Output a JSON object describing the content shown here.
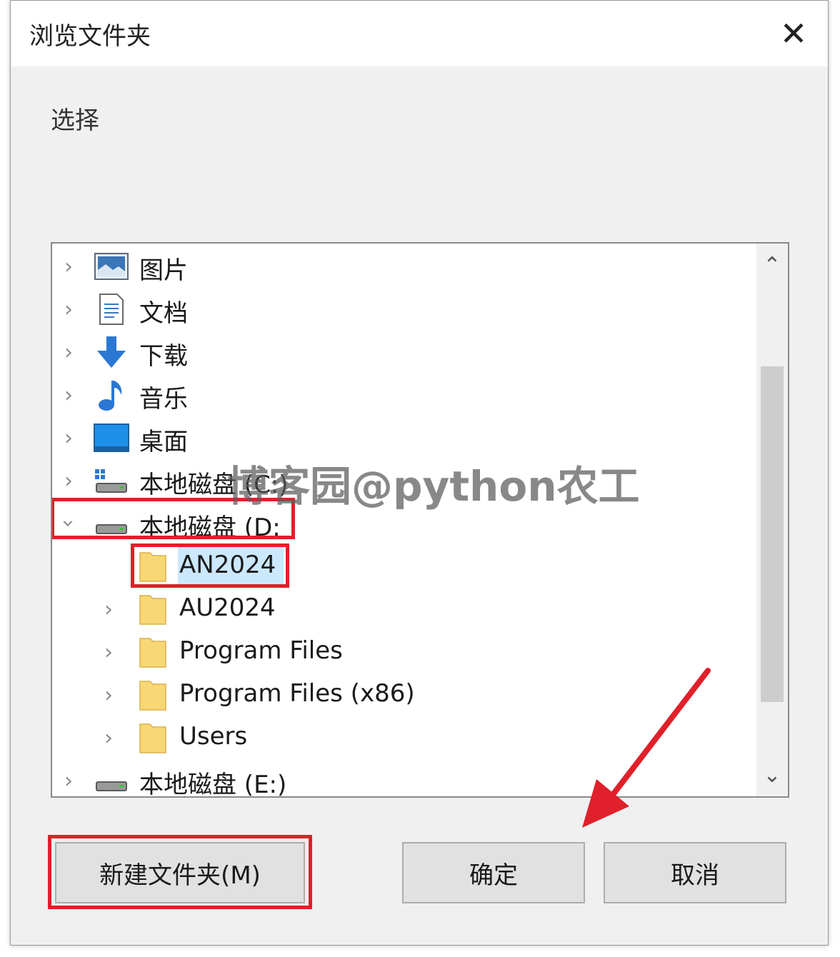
{
  "dialog": {
    "title": "浏览文件夹",
    "prompt": "选择",
    "close_glyph": "✕"
  },
  "tree": {
    "items": [
      {
        "label": "图片",
        "icon": "pictures-icon",
        "expanded": false
      },
      {
        "label": "文档",
        "icon": "documents-icon",
        "expanded": false
      },
      {
        "label": "下载",
        "icon": "download-icon",
        "expanded": false
      },
      {
        "label": "音乐",
        "icon": "music-icon",
        "expanded": false
      },
      {
        "label": "桌面",
        "icon": "desktop-icon",
        "expanded": false
      },
      {
        "label": "本地磁盘 (C:)",
        "icon": "system-drive-icon",
        "expanded": false
      },
      {
        "label": "本地磁盘 (D:",
        "icon": "drive-icon",
        "expanded": true
      },
      {
        "label": "AN2024",
        "icon": "folder-icon",
        "selected": true
      },
      {
        "label": "AU2024",
        "icon": "folder-icon",
        "expanded": false
      },
      {
        "label": "Program Files",
        "icon": "folder-icon",
        "expanded": false
      },
      {
        "label": "Program Files (x86)",
        "icon": "folder-icon",
        "expanded": false
      },
      {
        "label": "Users",
        "icon": "folder-icon",
        "expanded": false
      },
      {
        "label": "本地磁盘 (E:)",
        "icon": "drive-icon",
        "expanded": false
      }
    ]
  },
  "buttons": {
    "new_folder": "新建文件夹(M)",
    "ok": "确定",
    "cancel": "取消"
  },
  "watermark": "博客园@python农工",
  "colors": {
    "highlight_red": "#e0202a",
    "selection": "#cce8ff",
    "folder_yellow": "#f8d775"
  }
}
